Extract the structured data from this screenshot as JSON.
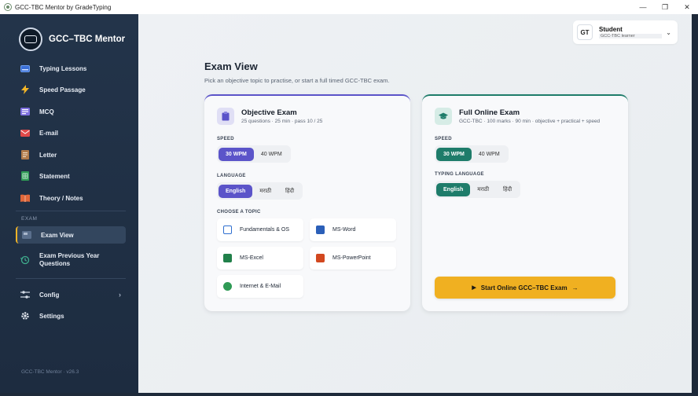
{
  "window": {
    "title": "GCC-TBC Mentor by GradeTyping"
  },
  "sidebar": {
    "brand": "GCC–TBC Mentor",
    "items": [
      {
        "label": "Typing Lessons",
        "icon": "keyboard-icon"
      },
      {
        "label": "Speed Passage",
        "icon": "bolt-icon"
      },
      {
        "label": "MCQ",
        "icon": "list-icon"
      },
      {
        "label": "E-mail",
        "icon": "mail-icon"
      },
      {
        "label": "Letter",
        "icon": "letter-icon"
      },
      {
        "label": "Statement",
        "icon": "sheet-icon"
      },
      {
        "label": "Theory / Notes",
        "icon": "book-icon"
      }
    ],
    "section_exam": "EXAM",
    "exam_items": [
      {
        "label": "Exam View",
        "icon": "exam-icon",
        "active": true
      },
      {
        "label": "Exam Previous Year Questions",
        "icon": "history-icon"
      }
    ],
    "bottom_items": [
      {
        "label": "Config",
        "icon": "sliders-icon"
      },
      {
        "label": "Settings",
        "icon": "gear-icon"
      }
    ],
    "version": "GCC-TBC Mentor · v26.3"
  },
  "user": {
    "initials": "GT",
    "name": "Student",
    "role": "GCC-TBC learner"
  },
  "page": {
    "title": "Exam View",
    "subtitle": "Pick an objective topic to practise, or start a full timed GCC-TBC exam."
  },
  "objective": {
    "title": "Objective Exam",
    "meta": "25 questions · 25 min · pass 10 / 25",
    "speed_label": "SPEED",
    "speeds": [
      "30 WPM",
      "40 WPM"
    ],
    "language_label": "LANGUAGE",
    "languages": [
      "English",
      "मराठी",
      "हिंदी"
    ],
    "topic_label": "CHOOSE A TOPIC",
    "topics": [
      "Fundamentals & OS",
      "MS-Word",
      "MS-Excel",
      "MS-PowerPoint",
      "Internet & E-Mail"
    ]
  },
  "full": {
    "title": "Full Online Exam",
    "meta": "GCC-TBC · 100 marks · 90 min · objective + practical + speed",
    "speed_label": "SPEED",
    "speeds": [
      "30 WPM",
      "40 WPM"
    ],
    "language_label": "TYPING LANGUAGE",
    "languages": [
      "English",
      "मराठी",
      "हिंदी"
    ],
    "start_label": "Start Online GCC–TBC Exam"
  },
  "colors": {
    "accent_objective": "#5b54c9",
    "accent_full": "#1e7c6a",
    "start_button": "#f0b021",
    "sidebar_active": "#f2b427"
  }
}
